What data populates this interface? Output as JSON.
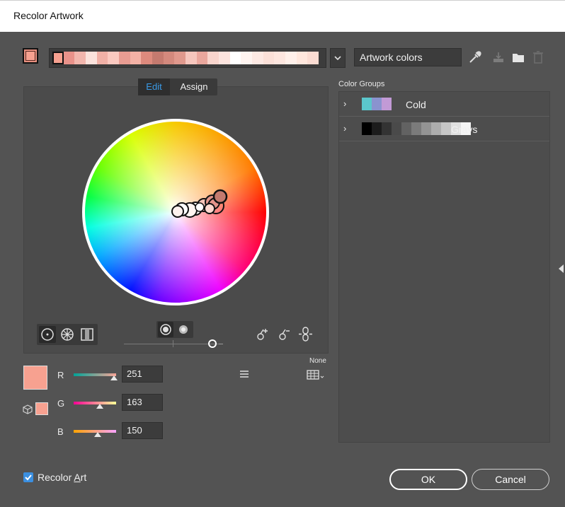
{
  "window": {
    "title": "Recolor Artwork"
  },
  "current_color": "#f7a190",
  "color_strip": [
    {
      "color": "#f7a190",
      "selected": true
    },
    {
      "color": "#e9928a"
    },
    {
      "color": "#f2b6ad"
    },
    {
      "color": "#fbe2dc"
    },
    {
      "color": "#f0b0a6"
    },
    {
      "color": "#fac9c0"
    },
    {
      "color": "#e89c92"
    },
    {
      "color": "#f4b2a6"
    },
    {
      "color": "#dd8a7d"
    },
    {
      "color": "#c47a6f"
    },
    {
      "color": "#d3897d"
    },
    {
      "color": "#e0998d"
    },
    {
      "color": "#f6c6bd"
    },
    {
      "color": "#eaa79d"
    },
    {
      "color": "#f9d5cd"
    },
    {
      "color": "#fde4de"
    },
    {
      "color": "#ffffff"
    },
    {
      "color": "#fff4f0"
    },
    {
      "color": "#fde9e3"
    },
    {
      "color": "#fbe0d8"
    },
    {
      "color": "#fde6df"
    },
    {
      "color": "#fff0ea"
    },
    {
      "color": "#ffe7dd"
    },
    {
      "color": "#fbdcd2"
    }
  ],
  "color_mode": "Artwork colors",
  "tabs": {
    "edit": "Edit",
    "assign": "Assign"
  },
  "color_groups": {
    "title": "Color Groups",
    "items": [
      {
        "name": "Cold",
        "swatches": [
          "#5bc7cc",
          "#8a93cf",
          "#c29ad6"
        ]
      },
      {
        "name": "Grays",
        "swatches": [
          "#000000",
          "#1c1c1c",
          "#333333",
          "#4a4a4a",
          "#626262",
          "#7b7b7b",
          "#949494",
          "#adadad",
          "#c6c6c6",
          "#e0e0e0",
          "#f5f5f5"
        ]
      }
    ]
  },
  "rgb": {
    "r": {
      "label": "R",
      "value": "251"
    },
    "g": {
      "label": "G",
      "value": "163"
    },
    "b": {
      "label": "B",
      "value": "150"
    }
  },
  "harmony": {
    "none_label": "None"
  },
  "recolor_art": {
    "label_prefix": "Recolor ",
    "label_underlined": "A",
    "label_suffix": "rt",
    "checked": true
  },
  "buttons": {
    "ok": "OK",
    "cancel": "Cancel"
  }
}
